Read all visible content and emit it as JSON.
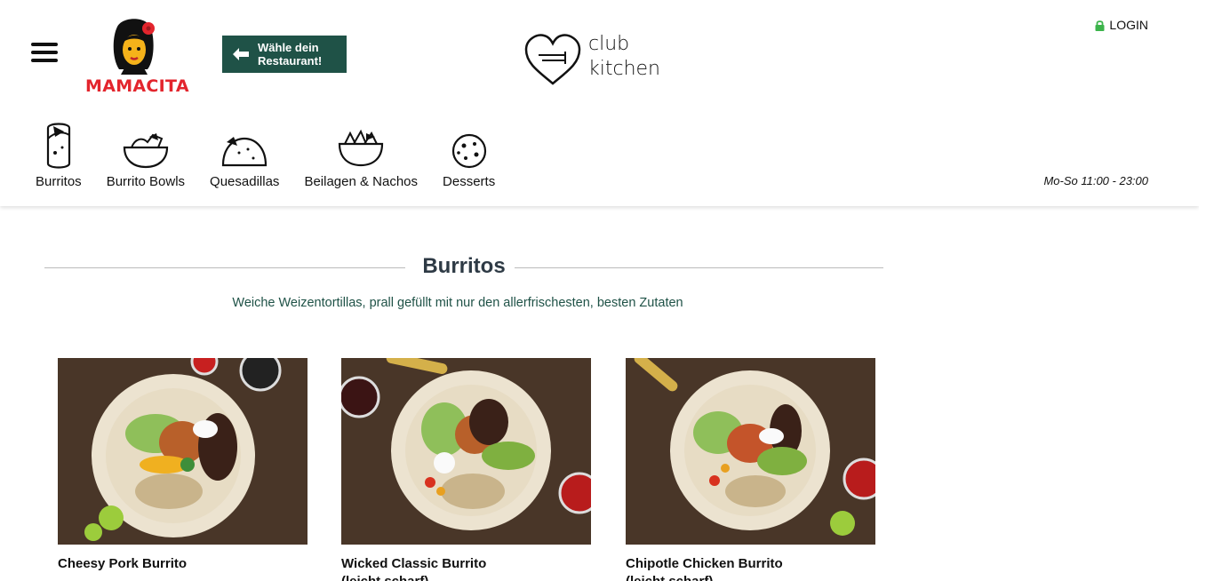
{
  "brand": {
    "name": "MAMACITA",
    "name_color": "#e3252d"
  },
  "header": {
    "menu_icon": "hamburger-icon",
    "restaurant_button": "Wähle dein\nRestaurant!",
    "restaurant_button_color": "#1f5247",
    "partner_logo": "club\nkitchen",
    "login_label": "LOGIN",
    "login_icon": "lock-icon",
    "lock_color": "#3cb44b",
    "opening_hours": "Mo-So 11:00 - 23:00"
  },
  "nav": {
    "items": [
      {
        "label": "Burritos",
        "icon": "burrito-icon"
      },
      {
        "label": "Burrito Bowls",
        "icon": "bowl-icon"
      },
      {
        "label": "Quesadillas",
        "icon": "quesadilla-icon"
      },
      {
        "label": "Beilagen & Nachos",
        "icon": "nachos-icon"
      },
      {
        "label": "Desserts",
        "icon": "cookie-icon"
      }
    ]
  },
  "section": {
    "title": "Burritos",
    "subtitle": "Weiche Weizentortillas, prall gefüllt mit nur den allerfrischesten, besten Zutaten"
  },
  "products": [
    {
      "name": "Cheesy Pork Burrito"
    },
    {
      "name": "Wicked Classic Burrito\n(leicht scharf)"
    },
    {
      "name": "Chipotle Chicken Burrito\n(leicht scharf)"
    }
  ]
}
